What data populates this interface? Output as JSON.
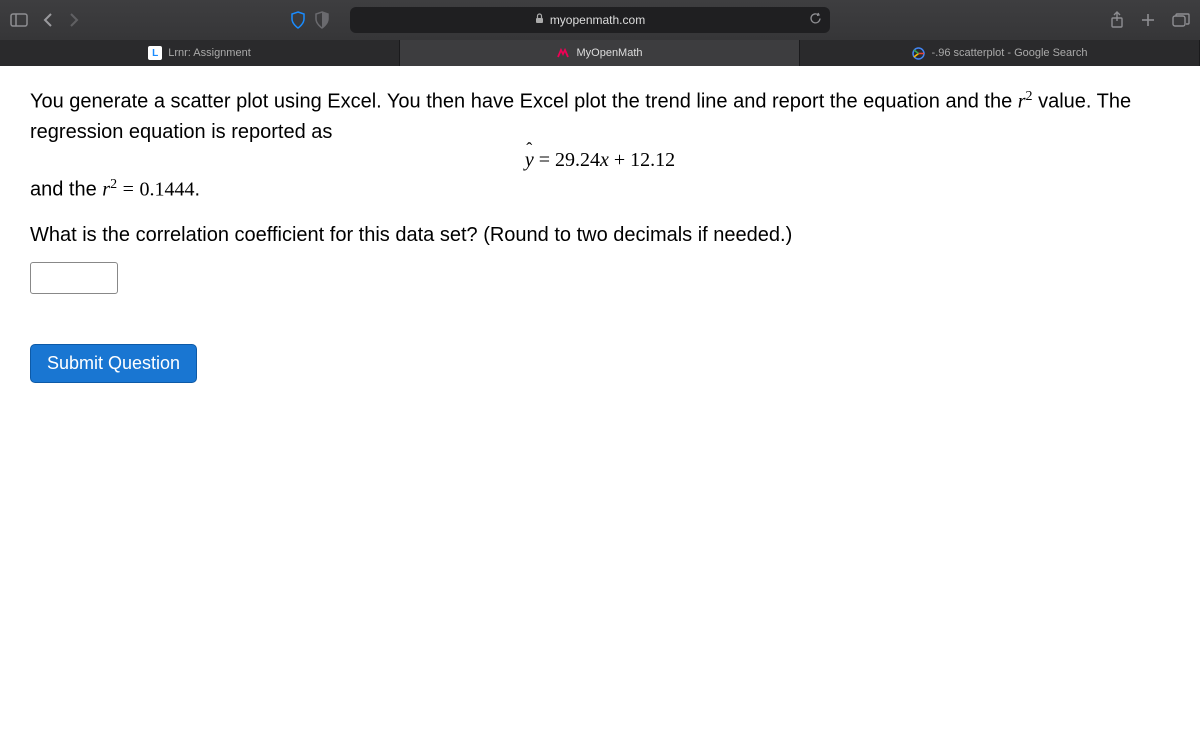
{
  "toolbar": {
    "address": "myopenmath.com"
  },
  "tabs": [
    {
      "label": "Lrnr: Assignment"
    },
    {
      "label": "MyOpenMath"
    },
    {
      "label": "-.96 scatterplot - Google Search"
    }
  ],
  "problem": {
    "intro_part1": "You generate a scatter plot using Excel. You then have Excel plot the trend line and report the equation and the ",
    "intro_part2": " value. The regression equation is reported as",
    "equation_lhs": "y",
    "equation_rhs": "29.24x + 12.12",
    "r2_prefix": "and the ",
    "r2_value": "0.1444",
    "r2_period": ".",
    "question": "What is the correlation coefficient for this data set? (Round to two decimals if needed.)",
    "submit_label": "Submit Question"
  }
}
